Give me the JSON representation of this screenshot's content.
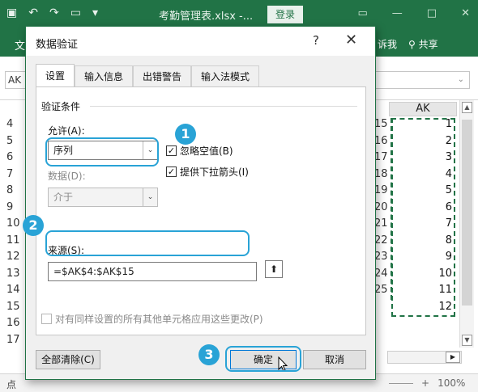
{
  "excel": {
    "title": "考勤管理表.xlsx -...",
    "login_label": "登录",
    "ribbon_left": "文",
    "ribbon_tell": "诉我",
    "share_label": "共享",
    "name_box": "AK",
    "column_header": "AK",
    "row_numbers": [
      "4",
      "5",
      "6",
      "7",
      "8",
      "9",
      "10",
      "11",
      "12",
      "13",
      "14",
      "15",
      "16",
      "17"
    ],
    "left_values": [
      "15",
      "16",
      "17",
      "18",
      "19",
      "20",
      "21",
      "22",
      "23",
      "24",
      "25"
    ],
    "ak_values": [
      "1",
      "2",
      "3",
      "4",
      "5",
      "6",
      "7",
      "8",
      "9",
      "10",
      "11",
      "12"
    ],
    "status_left": "点",
    "zoom": "100%"
  },
  "dialog": {
    "title": "数据验证",
    "help": "?",
    "close": "✕",
    "tabs": [
      "设置",
      "输入信息",
      "出错警告",
      "输入法模式"
    ],
    "group_title": "验证条件",
    "allow_label": "允许(A):",
    "allow_value": "序列",
    "data_label": "数据(D):",
    "data_value": "介于",
    "ignore_blank": "忽略空值(B)",
    "dropdown_arrow": "提供下拉箭头(I)",
    "source_label": "来源(S):",
    "source_value": "=$AK$4:$AK$15",
    "apply_all": "对有同样设置的所有其他单元格应用这些更改(P)",
    "clear_all": "全部清除(C)",
    "ok": "确定",
    "cancel": "取消"
  },
  "annotations": {
    "step1": "1",
    "step2": "2",
    "step3": "3",
    "color": "#29a3d6"
  }
}
